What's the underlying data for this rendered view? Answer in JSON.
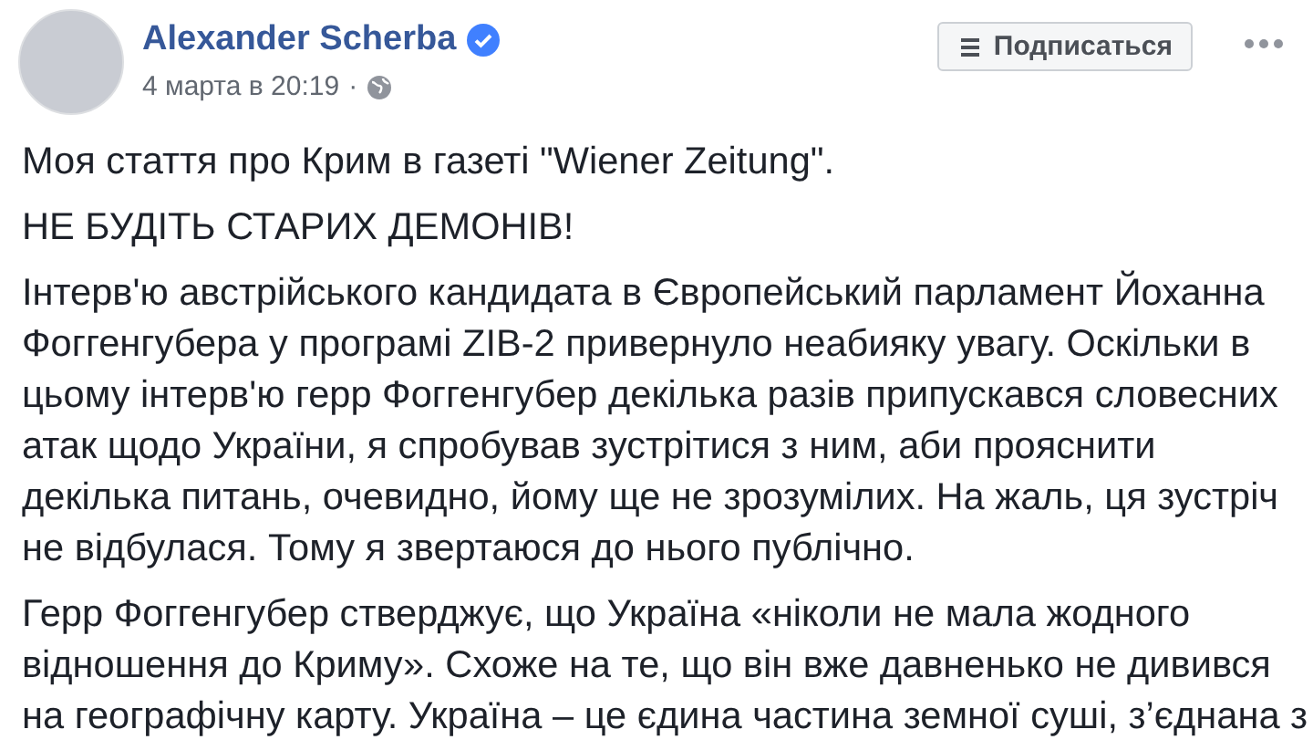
{
  "post": {
    "author": "Alexander Scherba",
    "verified": true,
    "date": "4 марта в 20:19",
    "separator": "·",
    "follow_button": "Подписаться",
    "paragraphs": [
      "Моя стаття про Крим в газеті \"Wiener Zeitung\".",
      "НЕ БУДІТЬ СТАРИХ ДЕМОНІВ!",
      "Інтерв'ю австрійського кандидата в Європейський парламент Йоханна Фоггенгубера у програмі ZIB-2 привернуло неабияку увагу. Оскільки в цьому інтерв'ю герр Фоггенгубер декілька разів припускався словесних атак щодо України, я спробував зустрітися з ним, аби прояснити декілька питань, очевидно, йому ще не зрозумілих. На жаль, ця зустріч не відбулася. Тому я звертаюся до нього публічно.",
      "Герр Фоггенгубер стверджує, що Україна «ніколи не мала жодного відношення до Криму». Схоже на те, що він вже давненько не дивився на географічну карту. Україна – це єдина частина земної суші, з’єднана з"
    ]
  }
}
